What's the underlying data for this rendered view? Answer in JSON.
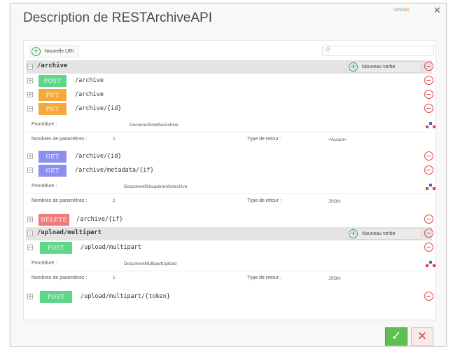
{
  "window": {
    "title": "Description de RESTArchiveAPI",
    "brand_a": "WIND",
    "brand_b": "EV",
    "close": "✕"
  },
  "toolbar": {
    "new_uri_label": "Nouvelle URI",
    "search_placeholder": ""
  },
  "icons": {
    "plus": "+",
    "expand": "+",
    "collapse": "−",
    "more": "...",
    "search": "⚲"
  },
  "colors": {
    "POST": "#5fd68a",
    "PUT": "#f5a93a",
    "GET": "#8c8ff2",
    "DELETE": "#f07b7b"
  },
  "resources": [
    {
      "path": "/archive",
      "new_verb_label": "Nouveau verbe"
    },
    {
      "path": "/upload/multipart",
      "new_verb_label": "Nouveau verbe"
    }
  ],
  "verbs": [
    {
      "method": "POST",
      "path": "/archive"
    },
    {
      "method": "PUT",
      "path": "/archive"
    },
    {
      "method": "PUT",
      "path": "/archive/{id}"
    },
    {
      "method": "GET",
      "path": "/archive/{id}"
    },
    {
      "method": "GET",
      "path": "/archive/metadata/{if}"
    },
    {
      "method": "DELETE",
      "path": "/archive/{if}"
    },
    {
      "method": "POST",
      "path": "/upload/multipart"
    },
    {
      "method": "POST",
      "path": "/upload/multipart/{token}"
    }
  ],
  "details": [
    {
      "procedure_label": "Procédure :",
      "procedure": "DocumentVérifieArchive",
      "params_label": "Nombres de paramètres :",
      "params": "1",
      "return_label": "Type de retour :",
      "return": "<Aucun>"
    },
    {
      "procedure_label": "Procédure :",
      "procedure": "DocumentRécupèreInfoArchive",
      "params_label": "Nombres de paramètres :",
      "params": "2",
      "return_label": "Type de retour :",
      "return": "JSON"
    },
    {
      "procedure_label": "Procédure :",
      "procedure": "DocumentMultipartUpload",
      "params_label": "Nombres de paramètres :",
      "params": "1",
      "return_label": "Type de retour :",
      "return": "JSON"
    }
  ],
  "footer": {
    "ok": "✓",
    "cancel": "✕"
  }
}
